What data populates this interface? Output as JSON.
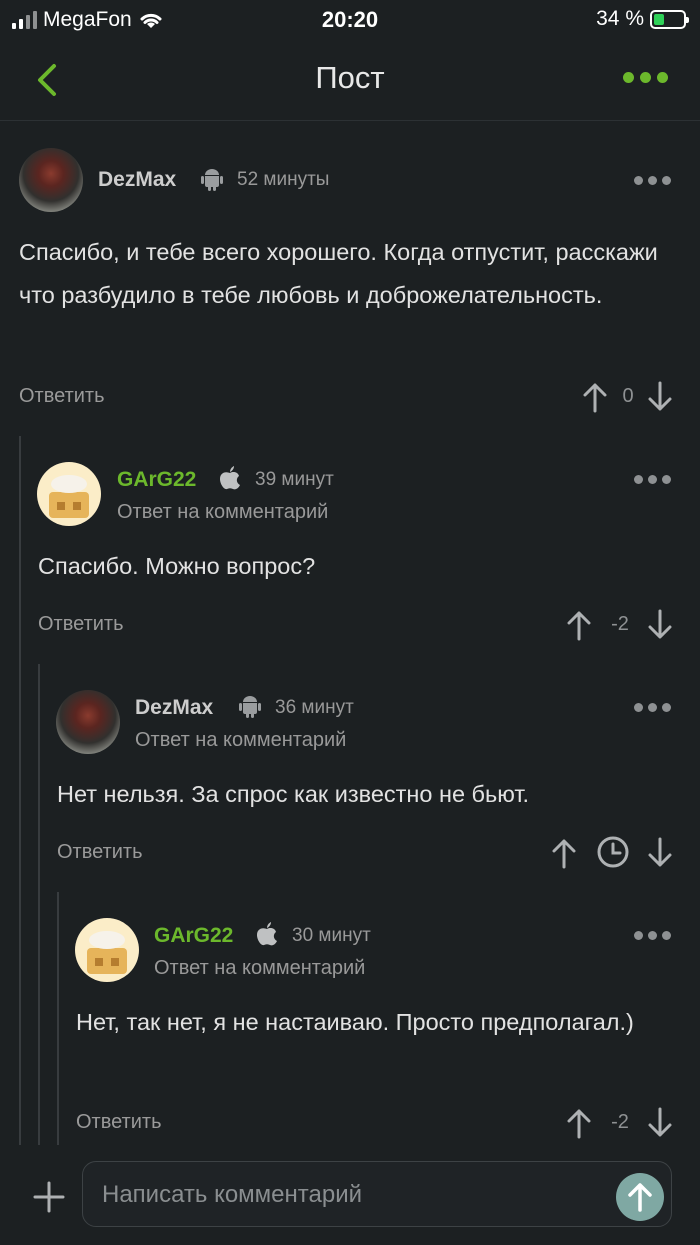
{
  "status_bar": {
    "carrier": "MegaFon",
    "time": "20:20",
    "battery": "34 %",
    "battery_level": 0.34
  },
  "nav": {
    "title": "Пост"
  },
  "comments": [
    {
      "user": "DezMax",
      "platform": "android-icon",
      "time": "52 минуты",
      "reply_to": "",
      "text": "Спасибо, и тебе всего хорошего. Когда отпустит, расскажи что разбудило в тебе любовь и доброжелательность.",
      "answer": "Ответить",
      "score": "0"
    },
    {
      "user": "GArG22",
      "platform": "apple-icon",
      "time": "39 минут",
      "reply_to": "Ответ на комментарий",
      "text": "Спасибо. Можно вопрос?",
      "answer": "Ответить",
      "score": "-2"
    },
    {
      "user": "DezMax",
      "platform": "android-icon",
      "time": "36 минут",
      "reply_to": "Ответ на комментарий",
      "text": "Нет нельзя. За спрос как известно не бьют.",
      "answer": "Ответить",
      "score": ""
    },
    {
      "user": "GArG22",
      "platform": "apple-icon",
      "time": "30 минут",
      "reply_to": "Ответ на комментарий",
      "text": "Нет, так нет, я не настаиваю. Просто предполагал.)",
      "answer": "Ответить",
      "score": "-2"
    }
  ],
  "composer": {
    "placeholder": "Написать комментарий"
  },
  "colors": {
    "accent": "#6cb82c",
    "background": "#1c2022"
  }
}
